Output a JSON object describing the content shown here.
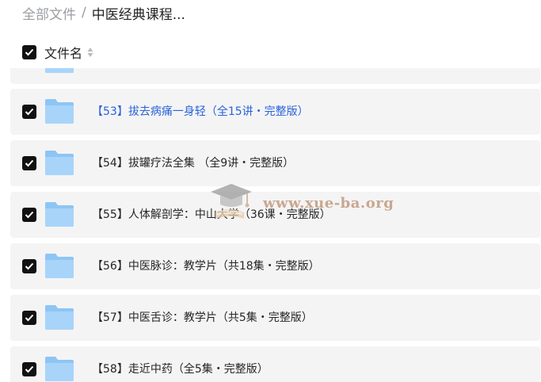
{
  "breadcrumb": {
    "root": "全部文件",
    "separator": "/",
    "current": "中医经典课程..."
  },
  "header": {
    "label": "文件名",
    "sort_icon": "sort-icon"
  },
  "rows": [
    {
      "name": ""
    },
    {
      "name": "【53】拔去病痛一身轻（全15讲・完整版）"
    },
    {
      "name": "【54】拔罐疗法全集 （全9讲・完整版）"
    },
    {
      "name": "【55】人体解剖学：中山大学（36课・完整版）"
    },
    {
      "name": "【56】中医脉诊：教学片（共18集・完整版）"
    },
    {
      "name": "【57】中医舌诊：教学片（共5集・完整版）"
    },
    {
      "name": "【58】走近中药（全5集・完整版）"
    }
  ],
  "watermark": {
    "text": "www.xue-ba.org"
  },
  "colors": {
    "checkbox": "#111111",
    "highlight_text": "#2a63d9",
    "row_bg": "#f4f4f5",
    "folder": "#8ec5f4"
  }
}
